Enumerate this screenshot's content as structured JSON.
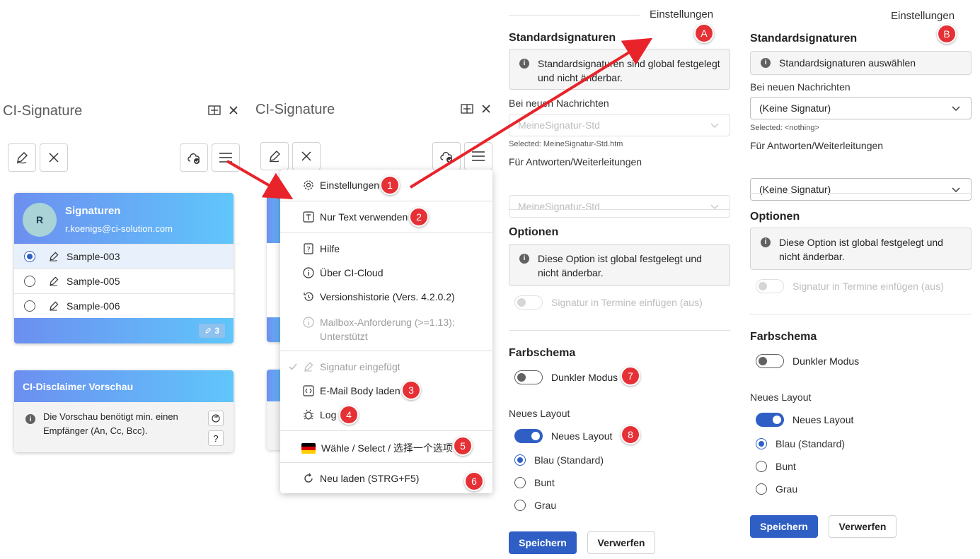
{
  "left_pane": {
    "title": "CI-Signature",
    "card": {
      "title": "Signaturen",
      "email": "r.koenigs@ci-solution.com",
      "avatar": "R",
      "items": [
        "Sample-003",
        "Sample-005",
        "Sample-006"
      ],
      "selected_index": 0,
      "count": "3"
    },
    "disclaimer": {
      "title": "CI-Disclaimer Vorschau",
      "text": "Die Vorschau benötigt min. einen Empfänger (An, Cc, Bcc).",
      "help": "?"
    }
  },
  "middle_pane": {
    "title": "CI-Signature",
    "menu": {
      "items": [
        {
          "label": "Einstellungen",
          "icon": "gear-icon",
          "badge": "1"
        },
        {
          "label": "Nur Text verwenden",
          "icon": "text-icon",
          "badge": "2"
        },
        {
          "label": "Hilfe",
          "icon": "help-icon"
        },
        {
          "label": "Über CI-Cloud",
          "icon": "info-icon"
        },
        {
          "label": "Versionshistorie (Vers. 4.2.0.2)",
          "icon": "history-icon"
        },
        {
          "label": "Mailbox-Anforderung (>=1.13):",
          "label2": "Unterstützt",
          "icon": "info-icon",
          "disabled": true
        },
        {
          "label": "Signatur eingefügt",
          "icon": "check-icon",
          "disabled": true
        },
        {
          "label": "E-Mail Body laden",
          "icon": "code-icon",
          "badge": "3"
        },
        {
          "label": "Log",
          "icon": "bug-icon",
          "badge": "4"
        },
        {
          "label": "Wähle / Select / 选择一个选项",
          "icon": "flag-de-icon",
          "badge": "5"
        },
        {
          "label": "Neu laden (STRG+F5)",
          "icon": "refresh-icon",
          "badge": "6"
        }
      ]
    }
  },
  "settings_a": {
    "title": "Einstellungen",
    "badge": "A",
    "standard": {
      "heading": "Standardsignaturen",
      "info": "Standardsignaturen sind global festgelegt und nicht änderbar.",
      "new_label": "Bei neuen Nachrichten",
      "new_value": "MeineSignatur-Std",
      "selected": "Selected: MeineSignatur-Std.htm",
      "reply_label": "Für Antworten/Weiterleitungen",
      "reply_value": "MeineSignatur-Std"
    },
    "options": {
      "heading": "Optionen",
      "info": "Diese Option ist global festgelegt und nicht änderbar.",
      "toggle_label": "Signatur in Termine einfügen (aus)"
    },
    "color": {
      "heading": "Farbschema",
      "dark_label": "Dunkler Modus",
      "dark_badge": "7"
    },
    "layout": {
      "heading": "Neues Layout",
      "toggle_label": "Neues Layout",
      "toggle_badge": "8",
      "radios": [
        "Blau (Standard)",
        "Bunt",
        "Grau"
      ],
      "selected_index": 0
    },
    "save": "Speichern",
    "discard": "Verwerfen"
  },
  "settings_b": {
    "title": "Einstellungen",
    "badge": "B",
    "standard": {
      "heading": "Standardsignaturen",
      "info": "Standardsignaturen auswählen",
      "new_label": "Bei neuen Nachrichten",
      "new_value": "(Keine Signatur)",
      "selected": "Selected: <nothing>",
      "reply_label": "Für Antworten/Weiterleitungen",
      "reply_value": "(Keine Signatur)"
    },
    "options": {
      "heading": "Optionen",
      "info": "Diese Option ist global festgelegt und nicht änderbar.",
      "toggle_label": "Signatur in Termine einfügen (aus)"
    },
    "color": {
      "heading": "Farbschema",
      "dark_label": "Dunkler Modus"
    },
    "layout": {
      "heading": "Neues Layout",
      "toggle_label": "Neues Layout",
      "radios": [
        "Blau (Standard)",
        "Bunt",
        "Grau"
      ],
      "selected_index": 0
    },
    "save": "Speichern",
    "discard": "Verwerfen"
  },
  "colors": {
    "accent": "#2f5fc4",
    "badge_red": "#e53035",
    "arrow_red": "#e8232a"
  }
}
